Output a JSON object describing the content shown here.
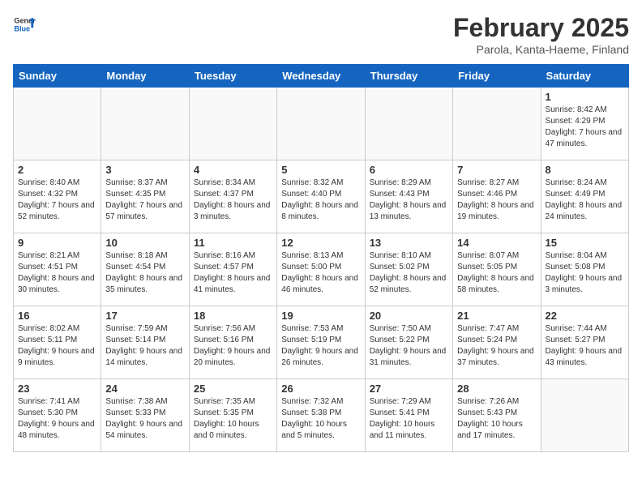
{
  "header": {
    "logo_general": "General",
    "logo_blue": "Blue",
    "title": "February 2025",
    "subtitle": "Parola, Kanta-Haeme, Finland"
  },
  "calendar": {
    "days_of_week": [
      "Sunday",
      "Monday",
      "Tuesday",
      "Wednesday",
      "Thursday",
      "Friday",
      "Saturday"
    ],
    "weeks": [
      [
        {
          "day": "",
          "info": ""
        },
        {
          "day": "",
          "info": ""
        },
        {
          "day": "",
          "info": ""
        },
        {
          "day": "",
          "info": ""
        },
        {
          "day": "",
          "info": ""
        },
        {
          "day": "",
          "info": ""
        },
        {
          "day": "1",
          "info": "Sunrise: 8:42 AM\nSunset: 4:29 PM\nDaylight: 7 hours and 47 minutes."
        }
      ],
      [
        {
          "day": "2",
          "info": "Sunrise: 8:40 AM\nSunset: 4:32 PM\nDaylight: 7 hours and 52 minutes."
        },
        {
          "day": "3",
          "info": "Sunrise: 8:37 AM\nSunset: 4:35 PM\nDaylight: 7 hours and 57 minutes."
        },
        {
          "day": "4",
          "info": "Sunrise: 8:34 AM\nSunset: 4:37 PM\nDaylight: 8 hours and 3 minutes."
        },
        {
          "day": "5",
          "info": "Sunrise: 8:32 AM\nSunset: 4:40 PM\nDaylight: 8 hours and 8 minutes."
        },
        {
          "day": "6",
          "info": "Sunrise: 8:29 AM\nSunset: 4:43 PM\nDaylight: 8 hours and 13 minutes."
        },
        {
          "day": "7",
          "info": "Sunrise: 8:27 AM\nSunset: 4:46 PM\nDaylight: 8 hours and 19 minutes."
        },
        {
          "day": "8",
          "info": "Sunrise: 8:24 AM\nSunset: 4:49 PM\nDaylight: 8 hours and 24 minutes."
        }
      ],
      [
        {
          "day": "9",
          "info": "Sunrise: 8:21 AM\nSunset: 4:51 PM\nDaylight: 8 hours and 30 minutes."
        },
        {
          "day": "10",
          "info": "Sunrise: 8:18 AM\nSunset: 4:54 PM\nDaylight: 8 hours and 35 minutes."
        },
        {
          "day": "11",
          "info": "Sunrise: 8:16 AM\nSunset: 4:57 PM\nDaylight: 8 hours and 41 minutes."
        },
        {
          "day": "12",
          "info": "Sunrise: 8:13 AM\nSunset: 5:00 PM\nDaylight: 8 hours and 46 minutes."
        },
        {
          "day": "13",
          "info": "Sunrise: 8:10 AM\nSunset: 5:02 PM\nDaylight: 8 hours and 52 minutes."
        },
        {
          "day": "14",
          "info": "Sunrise: 8:07 AM\nSunset: 5:05 PM\nDaylight: 8 hours and 58 minutes."
        },
        {
          "day": "15",
          "info": "Sunrise: 8:04 AM\nSunset: 5:08 PM\nDaylight: 9 hours and 3 minutes."
        }
      ],
      [
        {
          "day": "16",
          "info": "Sunrise: 8:02 AM\nSunset: 5:11 PM\nDaylight: 9 hours and 9 minutes."
        },
        {
          "day": "17",
          "info": "Sunrise: 7:59 AM\nSunset: 5:14 PM\nDaylight: 9 hours and 14 minutes."
        },
        {
          "day": "18",
          "info": "Sunrise: 7:56 AM\nSunset: 5:16 PM\nDaylight: 9 hours and 20 minutes."
        },
        {
          "day": "19",
          "info": "Sunrise: 7:53 AM\nSunset: 5:19 PM\nDaylight: 9 hours and 26 minutes."
        },
        {
          "day": "20",
          "info": "Sunrise: 7:50 AM\nSunset: 5:22 PM\nDaylight: 9 hours and 31 minutes."
        },
        {
          "day": "21",
          "info": "Sunrise: 7:47 AM\nSunset: 5:24 PM\nDaylight: 9 hours and 37 minutes."
        },
        {
          "day": "22",
          "info": "Sunrise: 7:44 AM\nSunset: 5:27 PM\nDaylight: 9 hours and 43 minutes."
        }
      ],
      [
        {
          "day": "23",
          "info": "Sunrise: 7:41 AM\nSunset: 5:30 PM\nDaylight: 9 hours and 48 minutes."
        },
        {
          "day": "24",
          "info": "Sunrise: 7:38 AM\nSunset: 5:33 PM\nDaylight: 9 hours and 54 minutes."
        },
        {
          "day": "25",
          "info": "Sunrise: 7:35 AM\nSunset: 5:35 PM\nDaylight: 10 hours and 0 minutes."
        },
        {
          "day": "26",
          "info": "Sunrise: 7:32 AM\nSunset: 5:38 PM\nDaylight: 10 hours and 5 minutes."
        },
        {
          "day": "27",
          "info": "Sunrise: 7:29 AM\nSunset: 5:41 PM\nDaylight: 10 hours and 11 minutes."
        },
        {
          "day": "28",
          "info": "Sunrise: 7:26 AM\nSunset: 5:43 PM\nDaylight: 10 hours and 17 minutes."
        },
        {
          "day": "",
          "info": ""
        }
      ]
    ]
  }
}
